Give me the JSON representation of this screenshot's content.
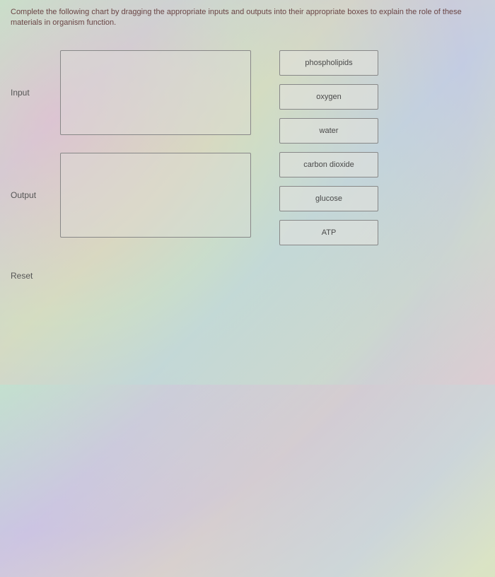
{
  "instructions": "Complete the following chart by dragging the appropriate inputs and outputs into their appropriate boxes to explain the role of these materials in organism function.",
  "labels": {
    "input": "Input",
    "output": "Output",
    "reset": "Reset"
  },
  "items": [
    "phospholipids",
    "oxygen",
    "water",
    "carbon dioxide",
    "glucose",
    "ATP"
  ]
}
